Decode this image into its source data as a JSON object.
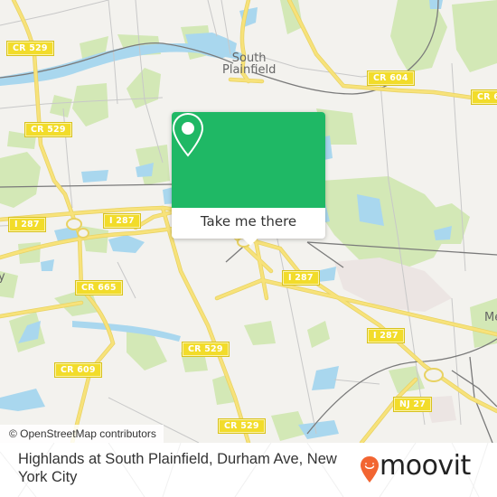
{
  "map": {
    "place_labels": [
      {
        "id": "south-plainfield",
        "text_line1": "South",
        "text_line2": "Plainfield"
      },
      {
        "id": "metuchen-partial",
        "text_line1": "Me",
        "text_line2": ""
      },
      {
        "id": "left-edge-partial",
        "text_line1": "y",
        "text_line2": ""
      }
    ],
    "road_shields": [
      {
        "id": "cr529-top-left",
        "label": "CR 529"
      },
      {
        "id": "cr529-left",
        "label": "CR 529"
      },
      {
        "id": "cr604",
        "label": "CR 604"
      },
      {
        "id": "cr6-right",
        "label": "CR 6"
      },
      {
        "id": "i287-left",
        "label": "I 287"
      },
      {
        "id": "i287-center-left",
        "label": "I 287"
      },
      {
        "id": "i287-center",
        "label": "I 287"
      },
      {
        "id": "i287-right",
        "label": "I 287"
      },
      {
        "id": "cr665",
        "label": "CR 665"
      },
      {
        "id": "cr529-mid",
        "label": "CR 529"
      },
      {
        "id": "cr609",
        "label": "CR 609"
      },
      {
        "id": "nj27",
        "label": "NJ 27"
      },
      {
        "id": "cr529-bottom",
        "label": "CR 529"
      }
    ],
    "attribution": "© OpenStreetMap contributors",
    "colors": {
      "land": "#f3f2ee",
      "park": "#cfe6b0",
      "water": "#a9d7ee",
      "road_major": "#f7e27a",
      "road_minor": "#c9c9c9",
      "rail": "#777777",
      "industrial": "#ece5e3"
    }
  },
  "popup": {
    "icon": "map-pin-icon",
    "button_label": "Take me there",
    "accent_color": "#1fb865"
  },
  "footer": {
    "title": "Highlands at South Plainfield, Durham Ave, New York City",
    "brand": "moovit",
    "brand_icon": "moovit-pin-logo-icon",
    "brand_color": "#f26531"
  }
}
